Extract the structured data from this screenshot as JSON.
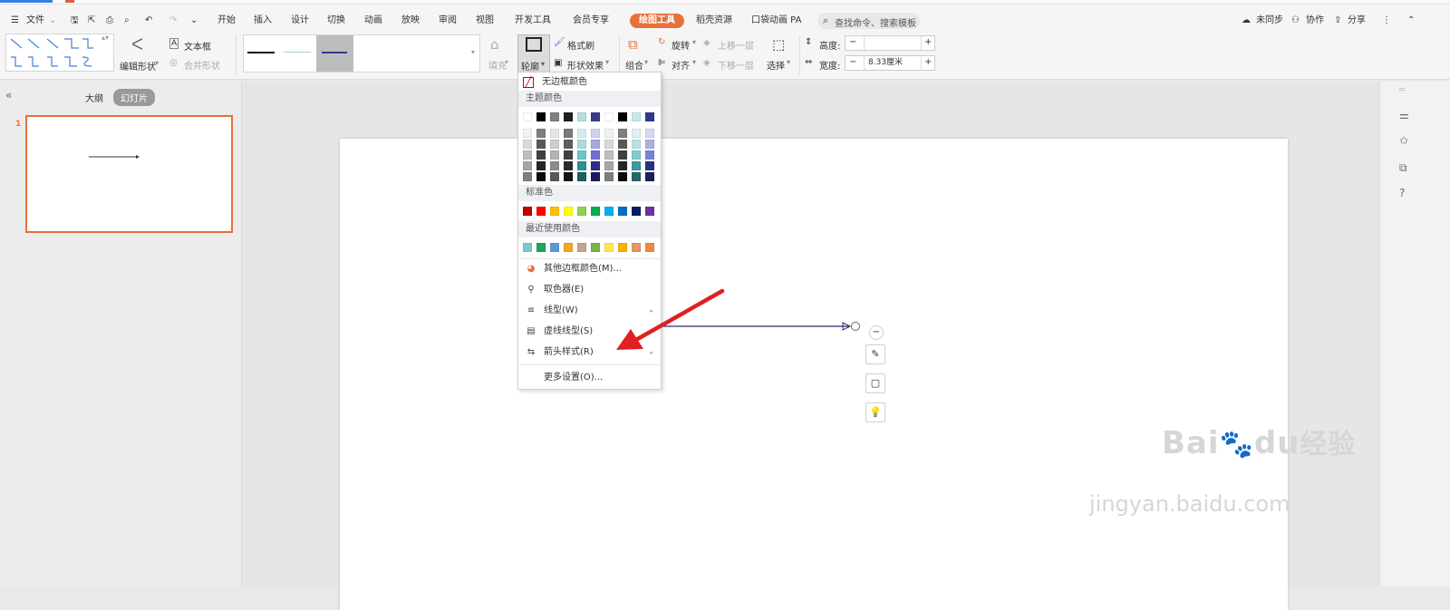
{
  "menubar": {
    "file_label": "文件",
    "tabs": [
      "开始",
      "插入",
      "设计",
      "切换",
      "动画",
      "放映",
      "审阅",
      "视图",
      "开发工具",
      "会员专享",
      "绘图工具",
      "稻壳资源",
      "口袋动画 PA"
    ],
    "active_tab": "绘图工具",
    "search_placeholder": "查找命令、搜索模板",
    "sync_label": "未同步",
    "collab_label": "协作",
    "share_label": "分享"
  },
  "ribbon": {
    "edit_shape": "编辑形状",
    "textbox": "文本框",
    "merge_shape": "合并形状",
    "fill": "填充",
    "outline": "轮廓",
    "format_painter": "格式刷",
    "shape_effect": "形状效果",
    "group": "组合",
    "rotate": "旋转",
    "align": "对齐",
    "bring_forward": "上移一层",
    "send_backward": "下移一层",
    "select": "选择",
    "height_label": "高度:",
    "width_label": "宽度:",
    "height_value": "",
    "width_value": "8.33厘米",
    "minus": "−",
    "plus": "+"
  },
  "sidebar": {
    "outline_tab": "大纲",
    "slides_tab": "幻灯片",
    "slide_number": "1"
  },
  "dropdown": {
    "no_border": "无边框颜色",
    "theme_colors": "主题颜色",
    "standard_colors": "标准色",
    "recent_colors": "最近使用颜色",
    "more_colors": "其他边框颜色(M)...",
    "eyedropper": "取色器(E)",
    "line_type": "线型(W)",
    "dash_type": "虚线线型(S)",
    "arrow_style": "箭头样式(R)",
    "more_settings": "更多设置(O)...",
    "theme_top_row": [
      "#ffffff",
      "#000000",
      "#7f7f7f",
      "#1f1f1f",
      "#b7dde0",
      "#3a3a8c",
      "#ffffff",
      "#000000",
      "#c9e6e8",
      "#2e3a8c"
    ],
    "theme_shades": [
      [
        "#f2f2f2",
        "#7f7f7f",
        "#e6e6e6",
        "#7a7a7a",
        "#d3eef0",
        "#d2d2f0",
        "#f2f2f2",
        "#7f7f7f",
        "#dff0f1",
        "#d5d8f3"
      ],
      [
        "#d9d9d9",
        "#595959",
        "#cfcfcf",
        "#5e5e5e",
        "#a7dde1",
        "#a6a6e2",
        "#d9d9d9",
        "#595959",
        "#bde2e5",
        "#abb1e6"
      ],
      [
        "#bfbfbf",
        "#404040",
        "#b3b3b3",
        "#414141",
        "#6fc3c9",
        "#6f6fcf",
        "#bfbfbf",
        "#404040",
        "#86cbd0",
        "#7a84d6"
      ],
      [
        "#a6a6a6",
        "#262626",
        "#8c8c8c",
        "#2c2c2c",
        "#2d8f96",
        "#2c2c8a",
        "#a6a6a6",
        "#262626",
        "#3c9aa1",
        "#28337f"
      ],
      [
        "#7f7f7f",
        "#0d0d0d",
        "#595959",
        "#151515",
        "#1e5f64",
        "#1d1d5c",
        "#7f7f7f",
        "#0d0d0d",
        "#286669",
        "#1b2255"
      ]
    ],
    "standard_row": [
      "#c00000",
      "#ff0000",
      "#ffc000",
      "#ffff00",
      "#92d050",
      "#00b050",
      "#00b0f0",
      "#0070c0",
      "#002060",
      "#7030a0"
    ],
    "recent_row": [
      "#7ec8cf",
      "#21a35a",
      "#5b9bd5",
      "#f5a623",
      "#c2a58a",
      "#7cb342",
      "#ffe84d",
      "#f5b400",
      "#e89560",
      "#ee8a3f"
    ]
  },
  "watermark": {
    "brand": "Bai",
    "brand2": "du",
    "cn": "经验",
    "url": "jingyan.baidu.com"
  },
  "colors": {
    "accent": "#e8703a",
    "arrow_red": "#e02020",
    "line_navy": "#2a2a6e"
  }
}
